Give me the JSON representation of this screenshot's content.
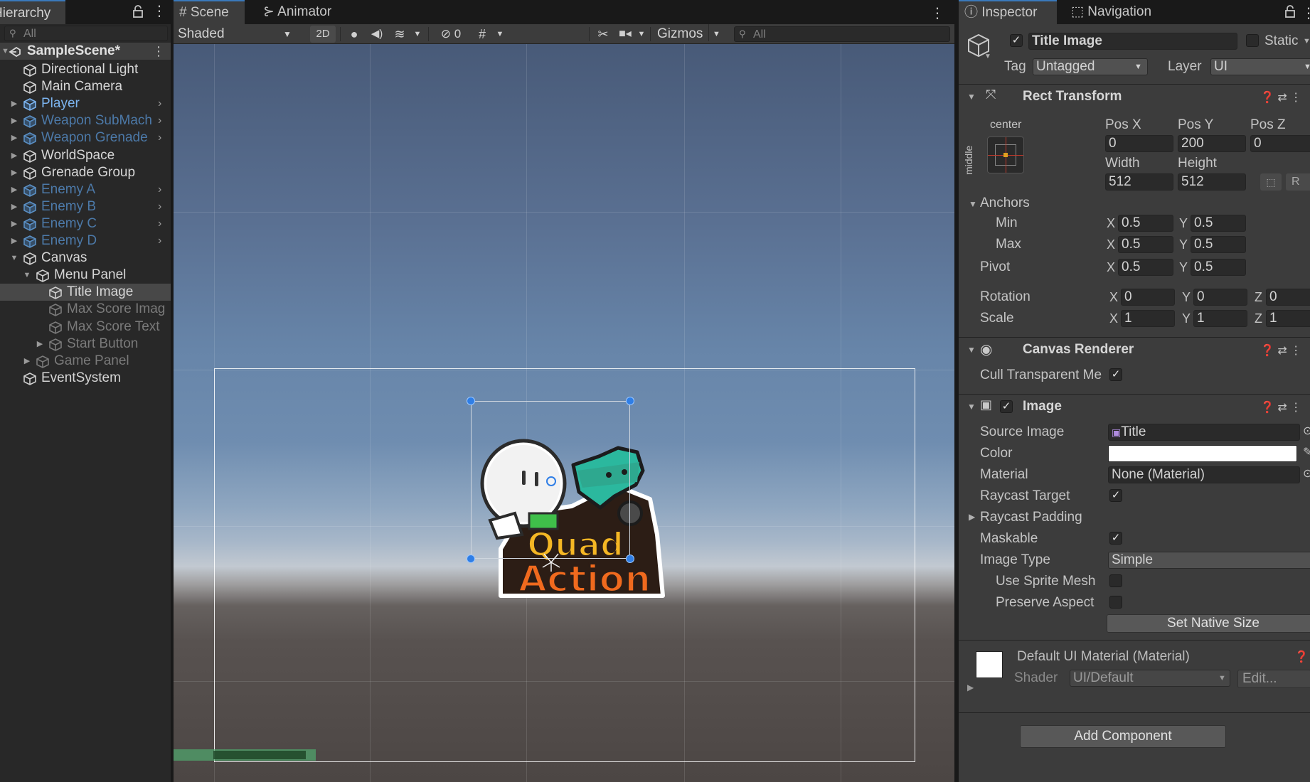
{
  "colors": {
    "accent": "#3a79bb",
    "prefab_blue": "#7cb4ef",
    "selected_row": "#484848",
    "panel_bg": "#282828",
    "inspector_bg": "#3c3c3c",
    "handle_blue": "#2f7ee6"
  },
  "hierarchy": {
    "tab_label": "Hierarchy",
    "search_placeholder": "All",
    "scene_name": "SampleScene*",
    "items": [
      {
        "label": "Directional Light",
        "color": "white",
        "indent": 0,
        "arrow": "",
        "chevron": false,
        "selected": false
      },
      {
        "label": "Main Camera",
        "color": "white",
        "indent": 0,
        "arrow": "",
        "chevron": false,
        "selected": false
      },
      {
        "label": "Player",
        "color": "blue",
        "indent": 0,
        "arrow": "collapsed",
        "chevron": true,
        "selected": false
      },
      {
        "label": "Weapon SubMach",
        "color": "blue-dim",
        "indent": 0,
        "arrow": "collapsed",
        "chevron": true,
        "selected": false
      },
      {
        "label": "Weapon Grenade",
        "color": "blue-dim",
        "indent": 0,
        "arrow": "collapsed",
        "chevron": true,
        "selected": false
      },
      {
        "label": "WorldSpace",
        "color": "white",
        "indent": 0,
        "arrow": "collapsed",
        "chevron": false,
        "selected": false
      },
      {
        "label": "Grenade Group",
        "color": "white",
        "indent": 0,
        "arrow": "collapsed",
        "chevron": false,
        "selected": false
      },
      {
        "label": "Enemy A",
        "color": "blue-dim",
        "indent": 0,
        "arrow": "collapsed",
        "chevron": true,
        "selected": false
      },
      {
        "label": "Enemy B",
        "color": "blue-dim",
        "indent": 0,
        "arrow": "collapsed",
        "chevron": true,
        "selected": false
      },
      {
        "label": "Enemy C",
        "color": "blue-dim",
        "indent": 0,
        "arrow": "collapsed",
        "chevron": true,
        "selected": false
      },
      {
        "label": "Enemy D",
        "color": "blue-dim",
        "indent": 0,
        "arrow": "collapsed",
        "chevron": true,
        "selected": false
      },
      {
        "label": "Canvas",
        "color": "white",
        "indent": 0,
        "arrow": "expanded",
        "chevron": false,
        "selected": false
      },
      {
        "label": "Menu Panel",
        "color": "white",
        "indent": 1,
        "arrow": "expanded",
        "chevron": false,
        "selected": false
      },
      {
        "label": "Title Image",
        "color": "white",
        "indent": 2,
        "arrow": "",
        "chevron": false,
        "selected": true
      },
      {
        "label": "Max Score Imag",
        "color": "dim",
        "indent": 2,
        "arrow": "",
        "chevron": false,
        "selected": false
      },
      {
        "label": "Max Score Text",
        "color": "dim",
        "indent": 2,
        "arrow": "",
        "chevron": false,
        "selected": false
      },
      {
        "label": "Start Button",
        "color": "dim",
        "indent": 2,
        "arrow": "collapsed",
        "chevron": false,
        "selected": false
      },
      {
        "label": "Game Panel",
        "color": "dim",
        "indent": 1,
        "arrow": "collapsed",
        "chevron": false,
        "selected": false
      },
      {
        "label": "EventSystem",
        "color": "white",
        "indent": 0,
        "arrow": "",
        "chevron": false,
        "selected": false
      }
    ]
  },
  "scene": {
    "tabs": [
      {
        "label": "Scene",
        "icon": "grid-icon"
      },
      {
        "label": "Animator",
        "icon": "animator-icon"
      }
    ],
    "shading_mode": "Shaded",
    "toggle_2d": "2D",
    "hidden_count": "0",
    "gizmos_label": "Gizmos",
    "search_placeholder": "All",
    "logo_line1": "Quad",
    "logo_line2": "Action"
  },
  "inspector": {
    "tabs": [
      {
        "label": "Inspector",
        "icon": "info-icon"
      },
      {
        "label": "Navigation",
        "icon": "navigation-icon"
      }
    ],
    "object_name": "Title Image",
    "active": true,
    "static_label": "Static",
    "tag_label": "Tag",
    "tag_value": "Untagged",
    "layer_label": "Layer",
    "layer_value": "UI",
    "rect_transform": {
      "title": "Rect Transform",
      "anchor_preset_h": "center",
      "anchor_preset_v": "middle",
      "pos_x_label": "Pos X",
      "pos_x": "0",
      "pos_y_label": "Pos Y",
      "pos_y": "200",
      "pos_z_label": "Pos Z",
      "pos_z": "0",
      "width_label": "Width",
      "width": "512",
      "height_label": "Height",
      "height": "512",
      "r_label": "R",
      "anchors_label": "Anchors",
      "min_label": "Min",
      "min_x": "0.5",
      "min_y": "0.5",
      "max_label": "Max",
      "max_x": "0.5",
      "max_y": "0.5",
      "pivot_label": "Pivot",
      "pivot_x": "0.5",
      "pivot_y": "0.5",
      "rotation_label": "Rotation",
      "rot_x": "0",
      "rot_y": "0",
      "rot_z": "0",
      "scale_label": "Scale",
      "scale_x": "1",
      "scale_y": "1",
      "scale_z": "1",
      "x": "X",
      "y": "Y",
      "z": "Z"
    },
    "canvas_renderer": {
      "title": "Canvas Renderer",
      "cull_label": "Cull Transparent Me",
      "cull_checked": true
    },
    "image": {
      "title": "Image",
      "enabled": true,
      "source_image_label": "Source Image",
      "source_image": "Title",
      "color_label": "Color",
      "color_value": "#ffffff",
      "material_label": "Material",
      "material": "None (Material)",
      "raycast_target_label": "Raycast Target",
      "raycast_target": true,
      "raycast_padding_label": "Raycast Padding",
      "maskable_label": "Maskable",
      "maskable": true,
      "image_type_label": "Image Type",
      "image_type": "Simple",
      "use_sprite_mesh_label": "Use Sprite Mesh",
      "use_sprite_mesh": false,
      "preserve_aspect_label": "Preserve Aspect",
      "preserve_aspect": false,
      "set_native_size": "Set Native Size"
    },
    "material_preview": {
      "title": "Default UI Material (Material)",
      "shader_label": "Shader",
      "shader_value": "UI/Default",
      "edit_label": "Edit..."
    },
    "add_component": "Add Component"
  }
}
